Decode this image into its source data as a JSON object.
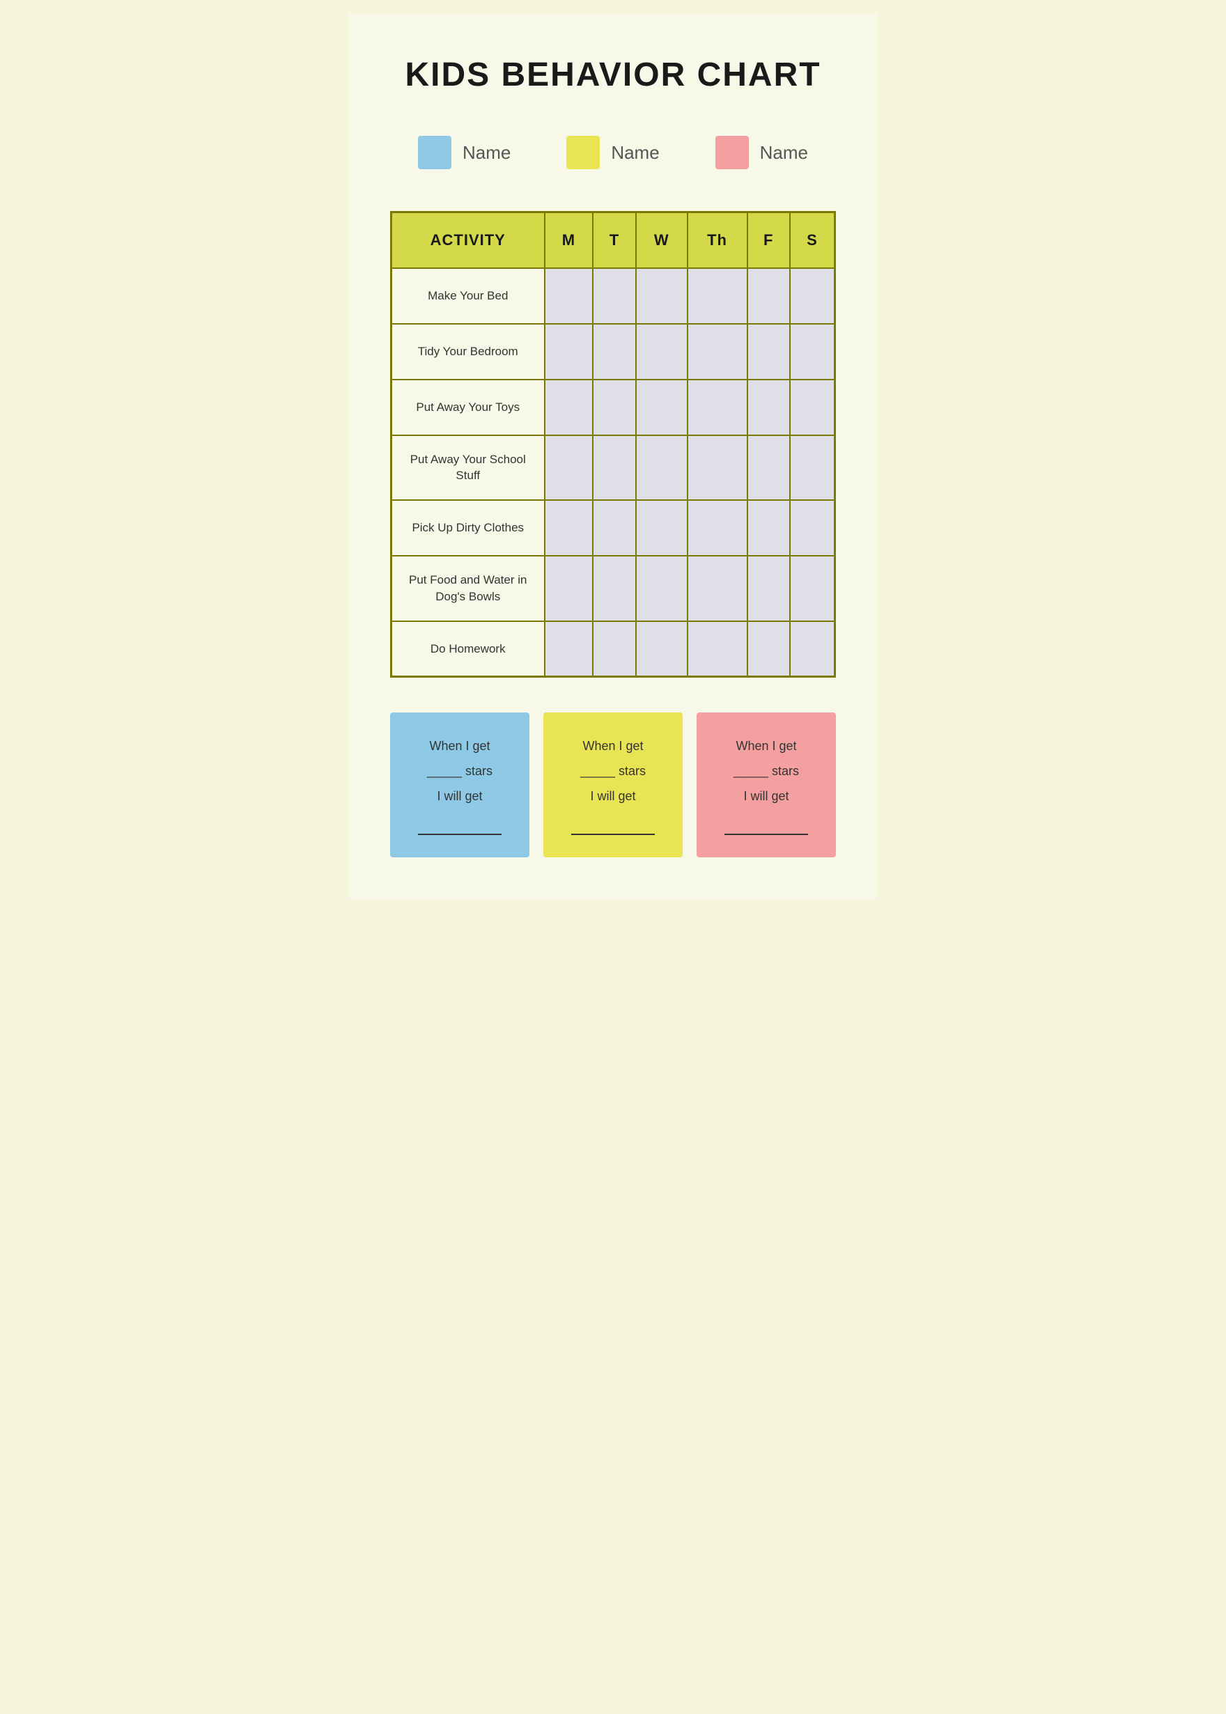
{
  "title": "KIDS BEHAVIOR CHART",
  "legend": {
    "items": [
      {
        "id": "blue",
        "color": "#8ecae6",
        "name": "Name"
      },
      {
        "id": "yellow",
        "color": "#e9e454",
        "name": "Name"
      },
      {
        "id": "pink",
        "color": "#f4a0a0",
        "name": "Name"
      }
    ]
  },
  "table": {
    "headers": [
      "ACTIVITY",
      "M",
      "T",
      "W",
      "Th",
      "F",
      "S"
    ],
    "rows": [
      "Make Your Bed",
      "Tidy Your Bedroom",
      "Put Away Your Toys",
      "Put Away Your School Stuff",
      "Pick Up Dirty Clothes",
      "Put Food and Water in Dog's Bowls",
      "Do Homework"
    ]
  },
  "rewards": [
    {
      "id": "blue",
      "color": "#8ecae6",
      "line1": "When I get",
      "line2": "_____ stars",
      "line3": "I will get",
      "line4": "_______________"
    },
    {
      "id": "yellow",
      "color": "#e9e454",
      "line1": "When I get",
      "line2": "_____ stars",
      "line3": "I will get",
      "line4": "_______________"
    },
    {
      "id": "pink",
      "color": "#f4a0a0",
      "line1": "When I get",
      "line2": "_____ stars",
      "line3": "I will get",
      "line4": "_______________"
    }
  ]
}
